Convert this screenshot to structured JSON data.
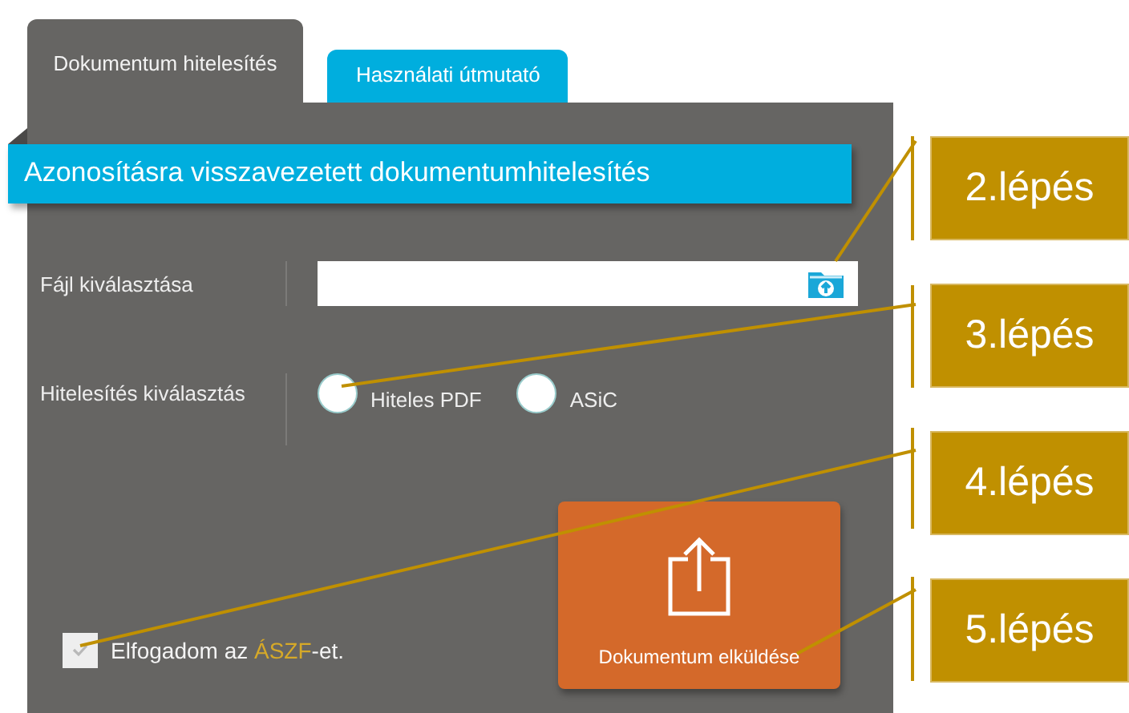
{
  "tabs": [
    {
      "label": "Dokumentum hitelesítés",
      "selected": true
    },
    {
      "label": "Használati útmutató",
      "selected": false
    }
  ],
  "banner": {
    "title": "Azonosításra visszavezetett dokumentumhitelesítés"
  },
  "file_row": {
    "label": "Fájl kiválasztása"
  },
  "auth_row": {
    "label": "Hitelesítés kiválasztás",
    "options": [
      {
        "label": "Hiteles PDF",
        "selected": false
      },
      {
        "label": "ASiC",
        "selected": false
      }
    ]
  },
  "accept": {
    "checked": true,
    "prefix": "Elfogadom az ",
    "link": "ÁSZF",
    "suffix": "-et."
  },
  "submit_button": {
    "label": "Dokumentum elküldése"
  },
  "callouts": [
    {
      "label": "2.lépés"
    },
    {
      "label": "3.lépés"
    },
    {
      "label": "4.lépés"
    },
    {
      "label": "5.lépés"
    }
  ]
}
